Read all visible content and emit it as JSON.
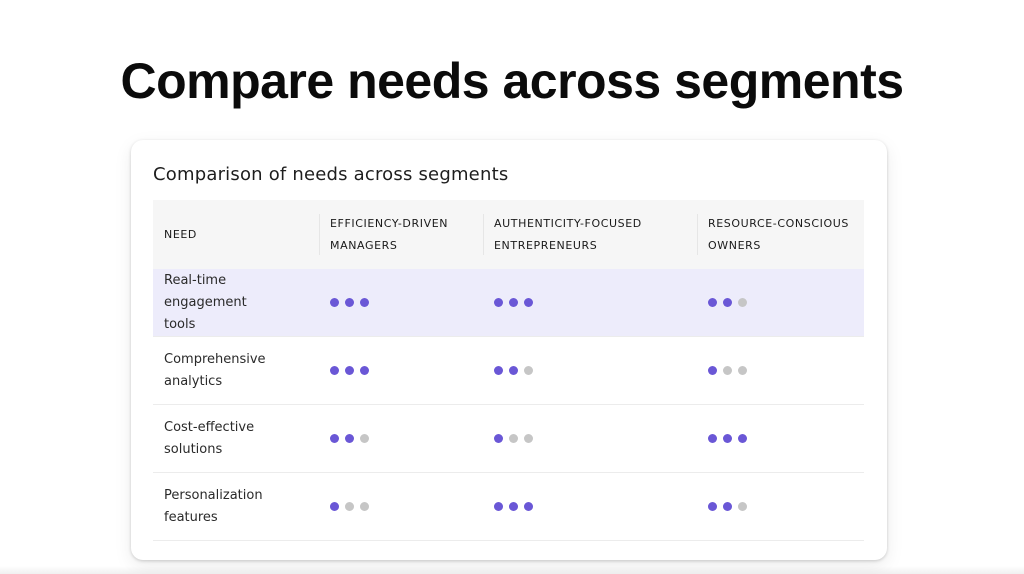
{
  "page": {
    "title": "Compare needs across segments"
  },
  "card": {
    "title": "Comparison of needs across segments"
  },
  "colors": {
    "dot_on": "#6a57d6",
    "dot_off": "#c6c6c6",
    "highlight_row": "#edecfb",
    "header_bg": "#f6f6f6"
  },
  "table": {
    "headers": [
      {
        "line1": "NEED",
        "line2": ""
      },
      {
        "line1": "EFFICIENCY-DRIVEN",
        "line2": "MANAGERS"
      },
      {
        "line1": "AUTHENTICITY-FOCUSED",
        "line2": "ENTREPRENEURS"
      },
      {
        "line1": "RESOURCE-CONSCIOUS",
        "line2": "OWNERS"
      }
    ],
    "max_rating": 3,
    "rows": [
      {
        "need_line1": "Real-time engagement",
        "need_line2": "tools",
        "highlighted": true,
        "ratings": [
          3,
          3,
          2
        ]
      },
      {
        "need_line1": "Comprehensive",
        "need_line2": "analytics",
        "highlighted": false,
        "ratings": [
          3,
          2,
          1
        ]
      },
      {
        "need_line1": "Cost-effective",
        "need_line2": "solutions",
        "highlighted": false,
        "ratings": [
          2,
          1,
          3
        ]
      },
      {
        "need_line1": "Personalization",
        "need_line2": "features",
        "highlighted": false,
        "ratings": [
          1,
          3,
          2
        ]
      }
    ]
  }
}
